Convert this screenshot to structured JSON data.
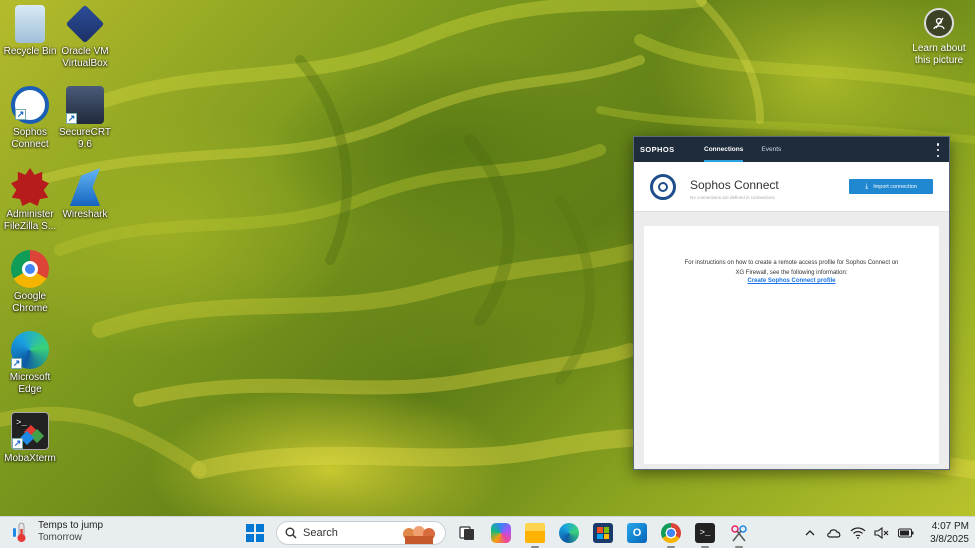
{
  "desktop": {
    "icons": [
      {
        "label": "Recycle Bin",
        "icon": "recycle-bin-icon"
      },
      {
        "label": "Oracle VM VirtualBox",
        "icon": "virtualbox-icon"
      },
      {
        "label": "Sophos Connect",
        "icon": "sophos-connect-icon"
      },
      {
        "label": "SecureCRT 9.6",
        "icon": "securecrt-icon"
      },
      {
        "label": "Administer FileZilla S...",
        "icon": "filezilla-icon"
      },
      {
        "label": "Wireshark",
        "icon": "wireshark-icon"
      },
      {
        "label": "Google Chrome",
        "icon": "chrome-icon"
      },
      {
        "label": "Microsoft Edge",
        "icon": "edge-icon"
      },
      {
        "label": "MobaXterm",
        "icon": "mobaxterm-icon"
      }
    ],
    "learn_about": "Learn about this picture"
  },
  "sophos": {
    "logo": "SOPHOS",
    "tabs": [
      {
        "label": "Connections",
        "active": true
      },
      {
        "label": "Events",
        "active": false
      }
    ],
    "title": "Sophos Connect",
    "subtitle": "No connections are defined in connections",
    "import_button": "Import connection",
    "message": "For instructions on how to create a remote access profile for Sophos Connect on XG Firewall, see the following information:",
    "link": "Create Sophos Connect profile",
    "accent_color": "#1f88d0",
    "header_color": "#1e2c3c"
  },
  "taskbar": {
    "weather_title": "Temps to jump",
    "weather_sub": "Tomorrow",
    "search_placeholder": "Search",
    "time": "4:07 PM",
    "date": "3/8/2025"
  }
}
